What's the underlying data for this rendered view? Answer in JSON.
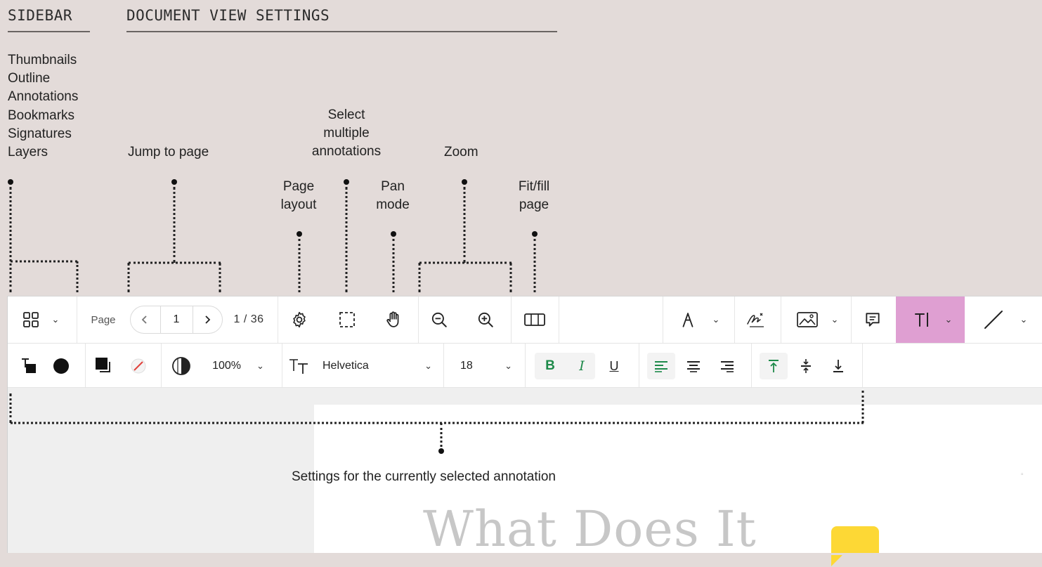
{
  "headers": {
    "sidebar": "SIDEBAR",
    "document_view_settings": "DOCUMENT VIEW SETTINGS"
  },
  "sidebar_items": [
    "Thumbnails",
    "Outline",
    "Annotations",
    "Bookmarks",
    "Signatures",
    "Layers"
  ],
  "callouts": {
    "jump_to_page": "Jump to page",
    "select_multiple": [
      "Select",
      "multiple",
      "annotations"
    ],
    "zoom": "Zoom",
    "page_layout": [
      "Page",
      "layout"
    ],
    "pan_mode": [
      "Pan",
      "mode"
    ],
    "fit_fill_page": [
      "Fit/fill",
      "page"
    ],
    "settings_selected": "Settings for the currently selected annotation"
  },
  "toolbar": {
    "page_label": "Page",
    "current_page": "1",
    "page_total": "1 / 36",
    "icons": [
      "thumbnails-grid-icon",
      "chevron-down-icon",
      "chevron-left-icon",
      "chevron-right-icon",
      "gear-icon",
      "marquee-select-icon",
      "hand-icon",
      "zoom-out-icon",
      "zoom-in-icon",
      "fit-page-icon",
      "ink-pen-icon",
      "signature-icon",
      "image-icon",
      "comment-icon",
      "text-tool-icon",
      "line-tool-icon"
    ],
    "active_tool_color": "#df9fd2"
  },
  "annotation_toolbar": {
    "opacity": "100%",
    "font": "Helvetica",
    "font_size": "18",
    "bold": "B",
    "italic": "I",
    "underline": "U",
    "accent_color": "#1e8a4a"
  },
  "document": {
    "title": "What Does It"
  }
}
